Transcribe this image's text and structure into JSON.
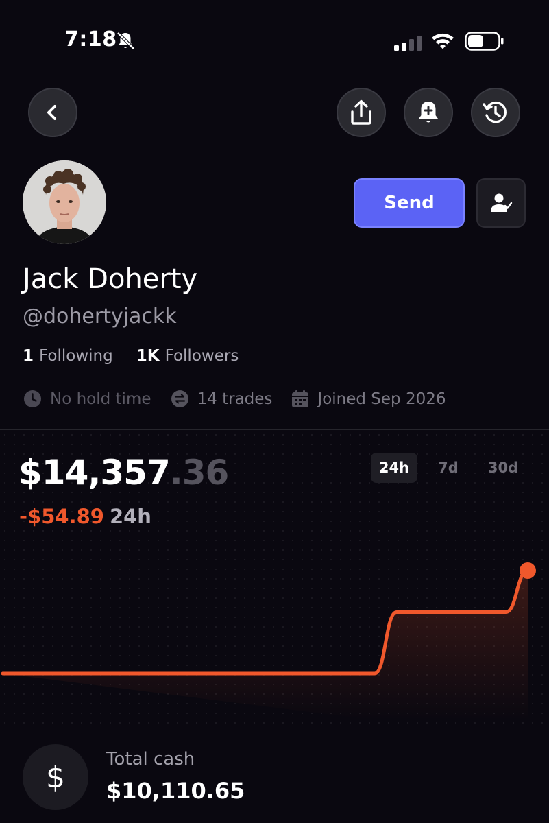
{
  "status_bar": {
    "time": "7:18"
  },
  "profile": {
    "name": "Jack Doherty",
    "handle": "@dohertyjackk",
    "following_count": "1",
    "following_label": "Following",
    "followers_count": "1K",
    "followers_label": "Followers",
    "hold_time": "No hold time",
    "trades": "14 trades",
    "joined": "Joined Sep 2026"
  },
  "actions": {
    "send_label": "Send"
  },
  "portfolio": {
    "balance_main": "$14,357",
    "balance_cents": ".36",
    "change_value": "-$54.89",
    "change_period": "24h",
    "ranges": [
      "24h",
      "7d",
      "30d"
    ],
    "selected_range": "24h"
  },
  "chart_data": {
    "type": "line",
    "x": [
      0,
      1,
      2,
      3,
      4,
      5,
      6,
      7,
      8,
      9,
      10,
      11,
      12,
      13,
      14,
      15,
      16,
      17,
      18,
      19,
      20,
      21,
      22,
      23,
      24
    ],
    "values": [
      14300,
      14300,
      14300,
      14300,
      14300,
      14300,
      14300,
      14300,
      14300,
      14300,
      14300,
      14300,
      14300,
      14300,
      14300,
      14300,
      14300,
      14300,
      14334,
      14334,
      14334,
      14334,
      14334,
      14334,
      14357
    ],
    "color": "#f0582c",
    "grid": false
  },
  "cash": {
    "label": "Total cash",
    "value": "$10,110.65",
    "icon": "$"
  },
  "colors": {
    "accent": "#5b63f5",
    "negative": "#f0582c",
    "background": "#0a0810"
  }
}
